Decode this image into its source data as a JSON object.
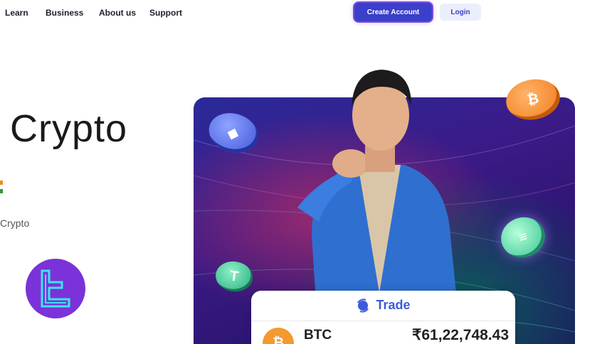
{
  "nav": {
    "links": [
      "Learn",
      "Business",
      "About us",
      "Support"
    ],
    "create_account": "Create Account",
    "login": "Login"
  },
  "hero": {
    "title": "Crypto",
    "subtitle": "Crypto"
  },
  "trade_card": {
    "title": "Trade",
    "asset_symbol": "BTC",
    "asset_price": "₹61,22,748.43"
  },
  "colors": {
    "accent": "#3b3fc9",
    "brand_purple": "#7b32d9",
    "trade_blue": "#3b5bdb",
    "btc_orange": "#f29a2e"
  },
  "icons": [
    "ethereum-coin-icon",
    "bitcoin-coin-icon",
    "solana-coin-icon",
    "tether-coin-icon",
    "brand-logo-icon",
    "trade-icon",
    "bitcoin-icon"
  ]
}
